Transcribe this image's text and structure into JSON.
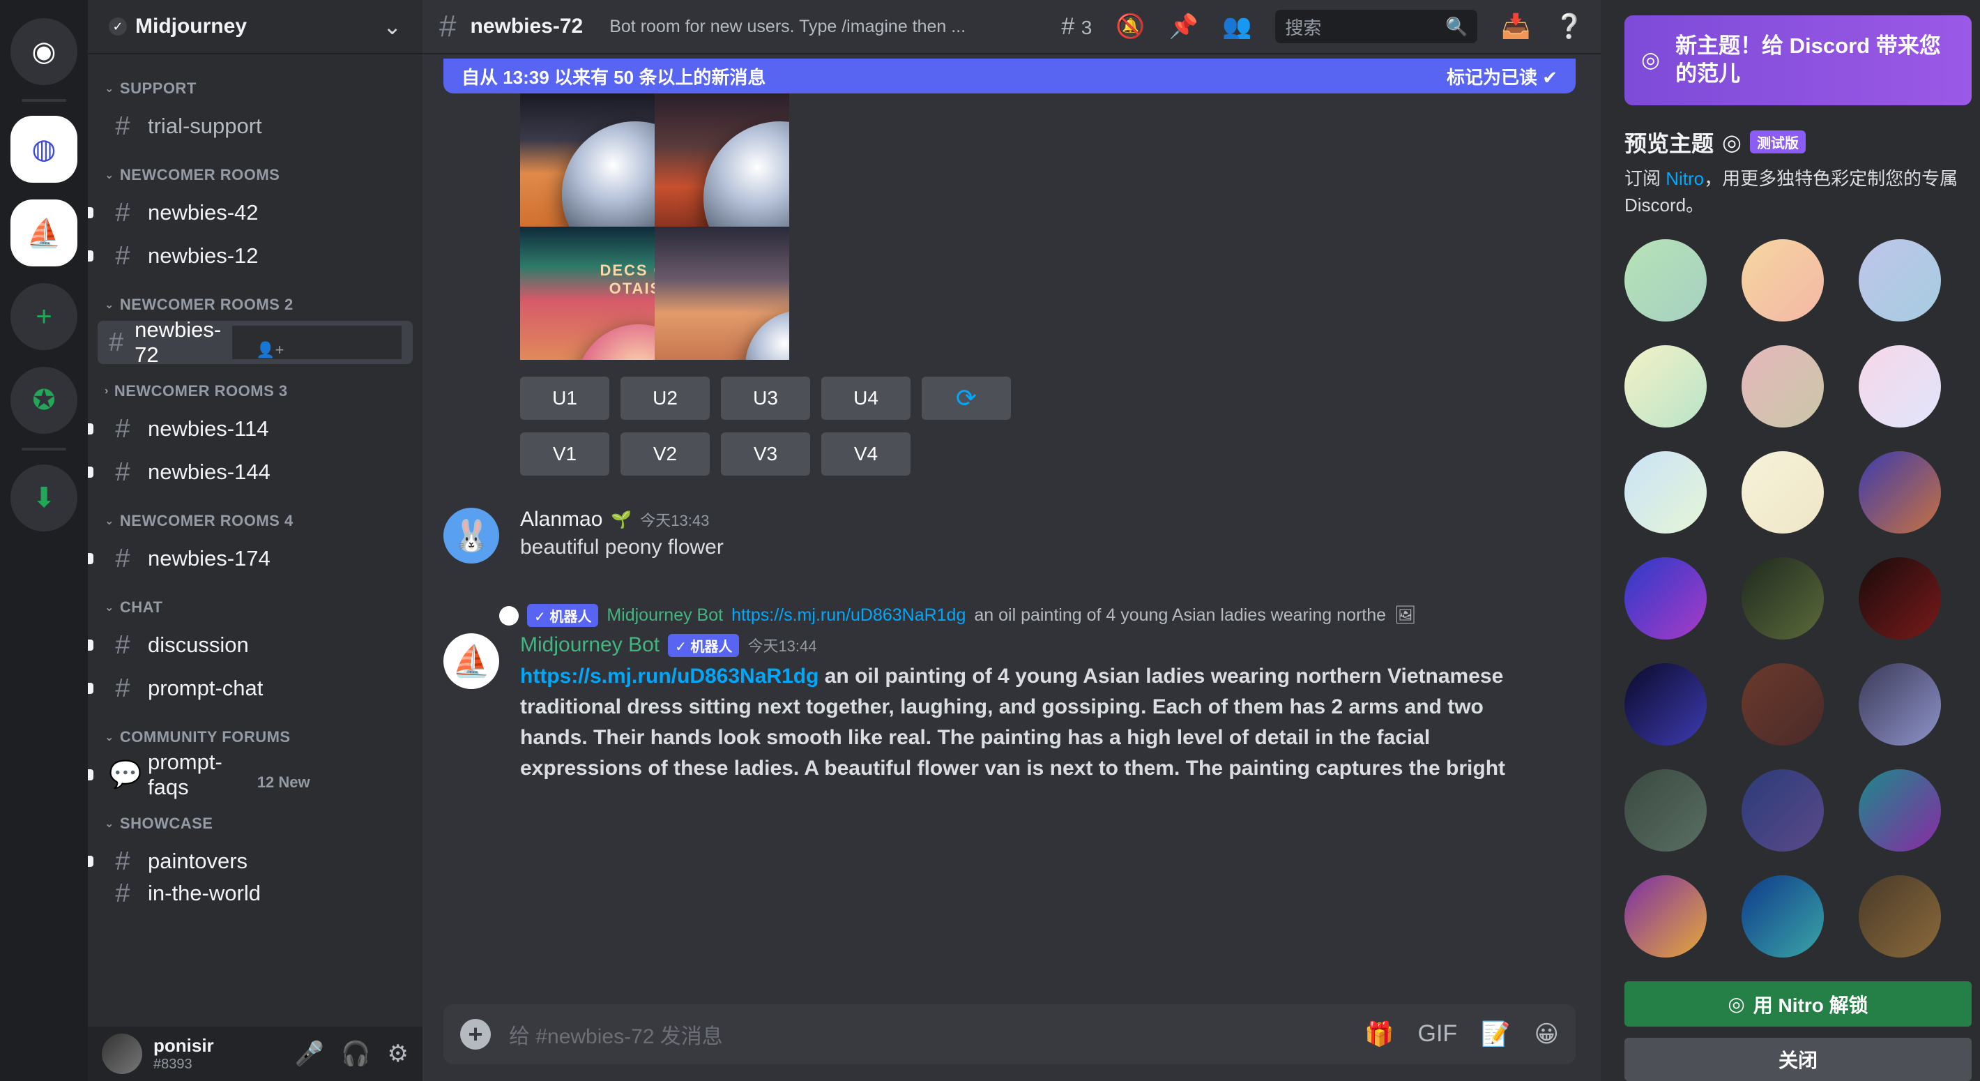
{
  "server": {
    "name": "Midjourney"
  },
  "channels": {
    "categories": [
      {
        "label": "SUPPORT",
        "items": [
          {
            "name": "trial-support"
          }
        ]
      },
      {
        "label": "NEWCOMER ROOMS",
        "items": [
          {
            "name": "newbies-42"
          },
          {
            "name": "newbies-12"
          }
        ]
      },
      {
        "label": "NEWCOMER ROOMS 2",
        "items": [
          {
            "name": "newbies-72"
          }
        ]
      },
      {
        "label": "NEWCOMER ROOMS 3",
        "items": [
          {
            "name": "newbies-114"
          },
          {
            "name": "newbies-144"
          }
        ]
      },
      {
        "label": "NEWCOMER ROOMS 4",
        "items": [
          {
            "name": "newbies-174"
          }
        ]
      },
      {
        "label": "CHAT",
        "items": [
          {
            "name": "discussion"
          },
          {
            "name": "prompt-chat"
          }
        ]
      },
      {
        "label": "COMMUNITY FORUMS",
        "items": [
          {
            "name": "prompt-faqs",
            "badge": "12 New"
          }
        ]
      },
      {
        "label": "SHOWCASE",
        "items": [
          {
            "name": "paintovers"
          },
          {
            "name": "in-the-world"
          }
        ]
      }
    ]
  },
  "user": {
    "name": "ponisir",
    "tag": "#8393"
  },
  "chat": {
    "channel": "newbies-72",
    "topic": "Bot room for new users. Type /imagine then ...",
    "threads_count": "3",
    "search_placeholder": "搜索",
    "banner_text": "自从 13:39 以来有 50 条以上的新消息",
    "banner_action": "标记为已读",
    "buttons_row1": [
      "U1",
      "U2",
      "U3",
      "U4"
    ],
    "buttons_row2": [
      "V1",
      "V2",
      "V3",
      "V4"
    ],
    "image_caption": "DECS CIC OTAISO",
    "msg1": {
      "author": "Alanmao",
      "time": "今天13:43",
      "text": "beautiful peony flower"
    },
    "reply": {
      "bot_tag": "✓ 机器人",
      "author": "Midjourney Bot",
      "link": "https://s.mj.run/uD863NaR1dg",
      "text": "an oil painting of 4 young Asian ladies wearing northe"
    },
    "msg2": {
      "author": "Midjourney Bot",
      "bot_tag": "✓ 机器人",
      "time": "今天13:44",
      "link": "https://s.mj.run/uD863NaR1dg",
      "text": "an oil painting of 4 young Asian ladies wearing northern Vietnamese traditional dress sitting next together, laughing, and gossiping. Each of them has 2 arms and two hands. Their hands look smooth like real. The painting has a high level of detail in the facial expressions of these ladies. A beautiful flower van is next to them. The painting captures the bright"
    },
    "composer_placeholder": "给 #newbies-72 发消息"
  },
  "right_panel": {
    "promo_text": "新主题！给 Discord 带来您的范儿",
    "preview_title": "预览主题",
    "beta": "测试版",
    "sub_prefix": "订阅 ",
    "sub_link": "Nitro",
    "sub_suffix": "，用更多独特色彩定制您的专属 Discord。",
    "unlock": "用 Nitro 解锁",
    "close": "关闭",
    "swatch_gradients": [
      "linear-gradient(135deg,#b7e3b6,#a6d0c1)",
      "linear-gradient(135deg,#f6d6a0,#f3b7a6)",
      "linear-gradient(135deg,#bfc5ea,#a6cde0)",
      "linear-gradient(135deg,#f3f1c6,#b9e4c9)",
      "linear-gradient(135deg,#e6b7bd,#c9c7a7)",
      "linear-gradient(135deg,#f8d6e9,#dfe6fb)",
      "linear-gradient(135deg,#c9e3f8,#e6f5d6)",
      "linear-gradient(135deg,#f6f2da,#efe6c6)",
      "linear-gradient(135deg,#3d3cae,#c7713f)",
      "linear-gradient(135deg,#2b3ac8,#a93bc7)",
      "linear-gradient(135deg,#1f2a1f,#5b6a3a)",
      "linear-gradient(135deg,#190b0b,#7a1a1a)",
      "linear-gradient(135deg,#0a0a2a,#3e3bb0)",
      "linear-gradient(135deg,#6b3a2b,#4a2a2a)",
      "linear-gradient(135deg,#3c3a5a,#8e94c8)",
      "linear-gradient(135deg,#3a4a42,#5a6e62)",
      "linear-gradient(135deg,#2c3b78,#5a4a8a)",
      "linear-gradient(135deg,#1c8a8a,#8a2aa5)",
      "linear-gradient(135deg,#7b2fa6,#e7a93a)",
      "linear-gradient(135deg,#0f3a8a,#3aa6a6)",
      "linear-gradient(135deg,#4a3a2a,#8a6a3a)"
    ]
  }
}
